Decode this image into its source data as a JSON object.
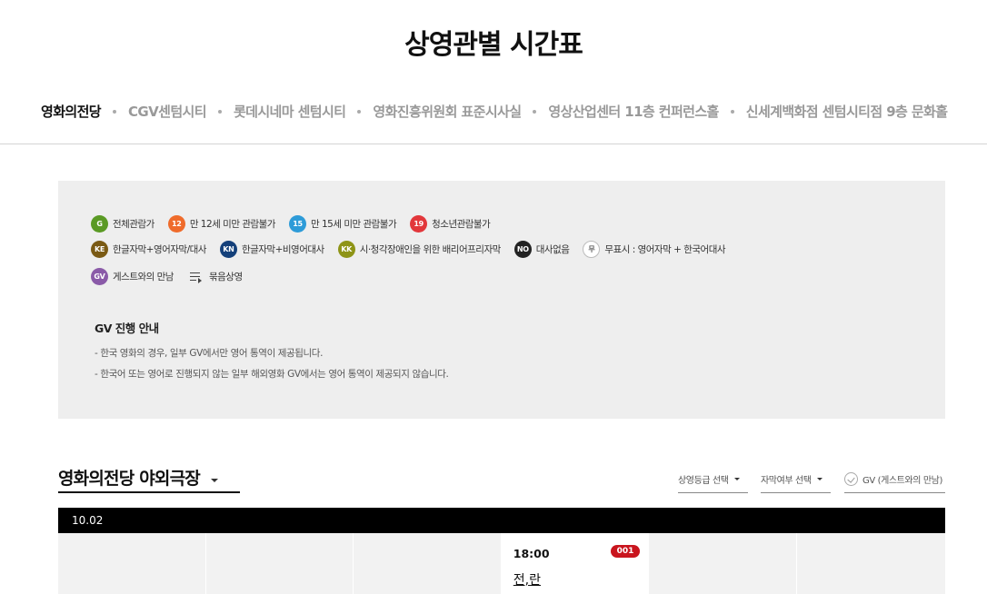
{
  "page": {
    "title": "상영관별 시간표"
  },
  "venues": [
    {
      "label": "영화의전당",
      "active": true
    },
    {
      "label": "CGV센텀시티",
      "active": false
    },
    {
      "label": "롯데시네마 센텀시티",
      "active": false
    },
    {
      "label": "영화진흥위원회 표준시사실",
      "active": false
    },
    {
      "label": "영상산업센터 11층 컨퍼런스홀",
      "active": false
    },
    {
      "label": "신세계백화점 센텀시티점 9층 문화홀",
      "active": false
    }
  ],
  "legend": {
    "rows": [
      [
        {
          "badge": "G",
          "color": "#5a9a24",
          "text": "전체관람가"
        },
        {
          "badge": "12",
          "color": "#ef6b2b",
          "text": "만 12세 미만 관람불가"
        },
        {
          "badge": "15",
          "color": "#2d9bd8",
          "text": "만 15세 미만 관람불가"
        },
        {
          "badge": "19",
          "color": "#e2373b",
          "text": "청소년관람불가"
        }
      ],
      [
        {
          "badge": "KE",
          "color": "#7a5a14",
          "text": "한글자막+영어자막/대사"
        },
        {
          "badge": "KN",
          "color": "#14407a",
          "text": "한글자막+비영어대사"
        },
        {
          "badge": "KK",
          "color": "#8e9416",
          "text": "시·청각장애인을 위한 배리어프리자막"
        },
        {
          "badge": "NO",
          "color": "#222222",
          "text": "대사없음"
        },
        {
          "badge": "무",
          "color": "#ffffff",
          "outline": true,
          "text": "무표시 : 영어자막 + 한국어대사"
        }
      ],
      [
        {
          "badge": "GV",
          "color": "#8a5aa8",
          "text": "게스트와의 만남"
        },
        {
          "icon": "bundle-list-icon",
          "text": "묶음상영"
        }
      ]
    ],
    "gv_title": "GV 진행 안내",
    "gv_notes": [
      "-  한국 영화의 경우, 일부 GV에서만 영어 통역이 제공됩니다.",
      "-  한국어 또는 영어로 진행되지 않는 일부 해외영화 GV에서는 영어 통역이 제공되지 않습니다."
    ]
  },
  "theater": {
    "selected": "영화의전당 야외극장"
  },
  "filters": {
    "rating": "상영등급 선택",
    "subtitle": "자막여부 선택",
    "gv": "GV (게스트와의 만남)"
  },
  "schedule": {
    "date": "10.02",
    "columns": 6,
    "shows": [
      {
        "column": 3,
        "time": "18:00",
        "code": "001",
        "title": "전,란"
      }
    ]
  },
  "colors": {
    "accent_red": "#c9151e",
    "date_bar": "#000000",
    "legend_bg": "#eeeeee"
  }
}
